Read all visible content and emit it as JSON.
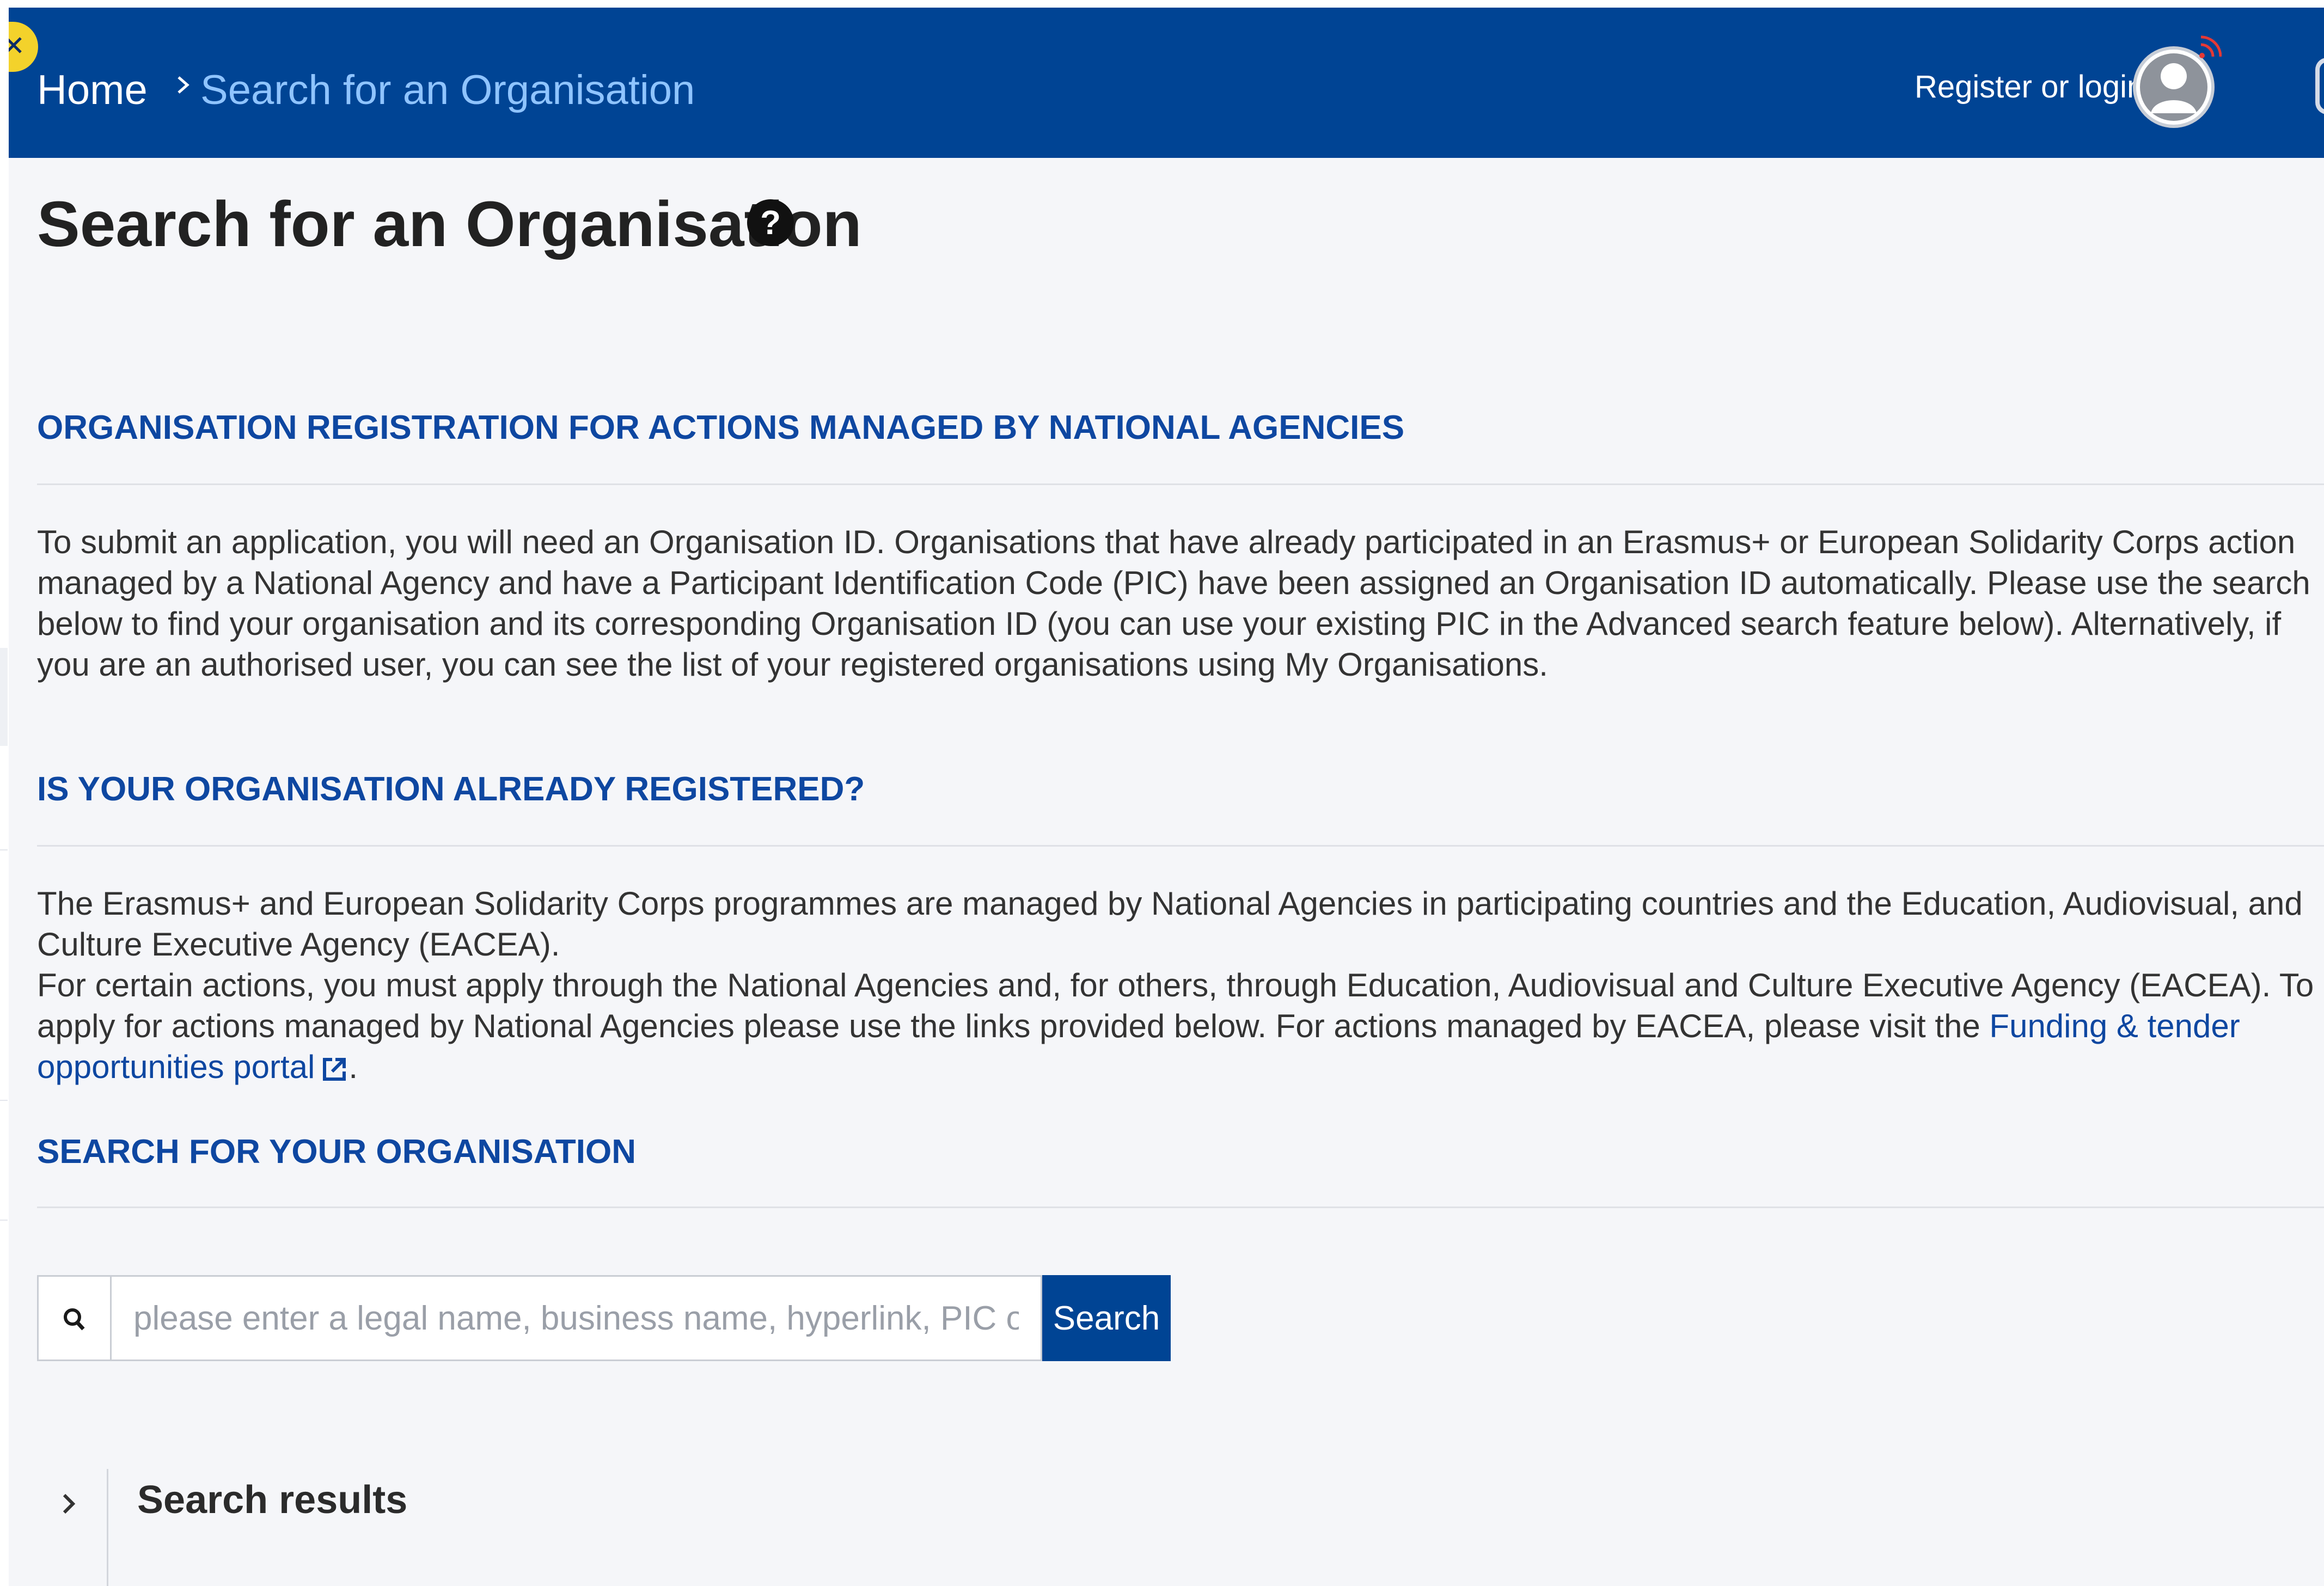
{
  "header": {
    "breadcrumb": {
      "home": "Home",
      "current": "Search for an Organisation"
    },
    "auth_link": "Register or login"
  },
  "page": {
    "title": "Search for an Organisation",
    "help_symbol": "?"
  },
  "sections": {
    "registration": {
      "heading": "ORGANISATION REGISTRATION FOR ACTIONS MANAGED BY NATIONAL AGENCIES",
      "text": "To submit an application, you will need an Organisation ID. Organisations that have already participated in an Erasmus+ or European Solidarity Corps action managed by a National Agency and have a Participant Identification Code (PIC) have been assigned an Organisation ID automatically. Please use the search below to find your organisation and its corresponding Organisation ID (you can use your existing PIC in the Advanced search feature below). Alternatively, if you are an authorised user, you can see the list of your registered organisations using My Organisations."
    },
    "already_registered": {
      "heading": "IS YOUR ORGANISATION ALREADY REGISTERED?",
      "text_1": "The Erasmus+ and European Solidarity Corps programmes are managed by National Agencies in participating countries and the Education, Audiovisual, and Culture Executive Agency (EACEA).",
      "text_2": "For certain actions, you must apply through the National Agencies and, for others, through Education, Audiovisual and Culture Executive Agency (EACEA). To apply for actions managed by National Agencies please use the links provided below. For actions managed by EACEA, please visit the",
      "link_label": "Funding & tender opportunities portal",
      "text_end": "."
    },
    "search": {
      "heading": "SEARCH FOR YOUR ORGANISATION",
      "placeholder": "please enter a legal name, business name, hyperlink, PIC or an OID",
      "value": "",
      "button_label": "Search"
    },
    "results": {
      "title": "Search results"
    }
  },
  "icons": {
    "close": "close-icon",
    "chevron": "chevron-right-icon",
    "avatar": "user-avatar-icon",
    "help": "help-icon",
    "external": "external-link-icon",
    "search": "search-icon",
    "results_toggle": "chevron-right-icon"
  },
  "colors": {
    "header_bg": "#004494",
    "breadcrumb_current": "#8fc4ff",
    "heading_blue": "#0e47a1",
    "page_bg": "#f5f6f9",
    "badge_yellow": "#f3d22b"
  }
}
